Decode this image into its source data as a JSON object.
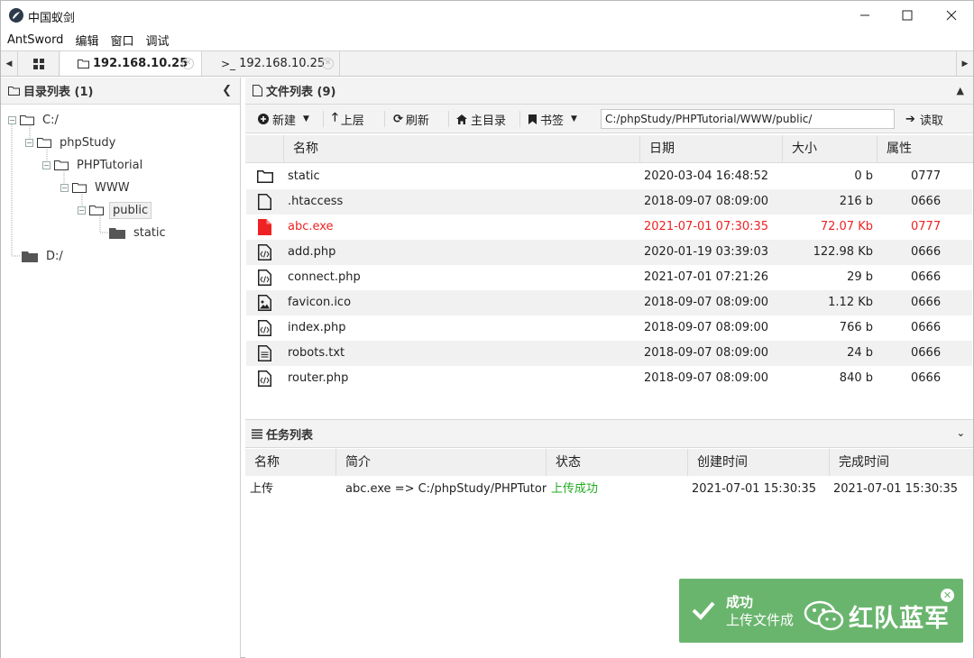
{
  "window": {
    "title": "中国蚁剑"
  },
  "menu": [
    "AntSword",
    "编辑",
    "窗口",
    "调试"
  ],
  "tabs": [
    {
      "label": "192.168.10.25"
    },
    {
      "label": "192.168.10.25"
    }
  ],
  "sidebar": {
    "title": "目录列表 (1)",
    "tree": [
      {
        "label": "C:/"
      },
      {
        "label": "phpStudy"
      },
      {
        "label": "PHPTutorial"
      },
      {
        "label": "WWW"
      },
      {
        "label": "public"
      },
      {
        "label": "static"
      },
      {
        "label": "D:/"
      }
    ]
  },
  "files": {
    "title": "文件列表 (9)",
    "toolbar": {
      "new_label": "新建",
      "up_label": "上层",
      "refresh_label": "刷新",
      "home_label": "主目录",
      "bookmark_label": "书签",
      "read_label": "读取",
      "path_value": "C:/phpStudy/PHPTutorial/WWW/public/"
    },
    "columns": [
      "名称",
      "日期",
      "大小",
      "属性"
    ],
    "rows": [
      {
        "icon": "folder-icon",
        "name": "static",
        "date": "2020-03-04 16:48:52",
        "size": "0 b",
        "attr": "0777"
      },
      {
        "icon": "file-icon",
        "name": ".htaccess",
        "date": "2018-09-07 08:09:00",
        "size": "216 b",
        "attr": "0666"
      },
      {
        "icon": "exe-file-icon",
        "name": "abc.exe",
        "date": "2021-07-01 07:30:35",
        "size": "72.07 Kb",
        "attr": "0777",
        "highlight": "#ee2222"
      },
      {
        "icon": "code-file-icon",
        "name": "add.php",
        "date": "2020-01-19 03:39:03",
        "size": "122.98 Kb",
        "attr": "0666"
      },
      {
        "icon": "code-file-icon",
        "name": "connect.php",
        "date": "2021-07-01 07:21:26",
        "size": "29 b",
        "attr": "0666"
      },
      {
        "icon": "image-file-icon",
        "name": "favicon.ico",
        "date": "2018-09-07 08:09:00",
        "size": "1.12 Kb",
        "attr": "0666"
      },
      {
        "icon": "code-file-icon",
        "name": "index.php",
        "date": "2018-09-07 08:09:00",
        "size": "766 b",
        "attr": "0666"
      },
      {
        "icon": "text-file-icon",
        "name": "robots.txt",
        "date": "2018-09-07 08:09:00",
        "size": "24 b",
        "attr": "0666"
      },
      {
        "icon": "code-file-icon",
        "name": "router.php",
        "date": "2018-09-07 08:09:00",
        "size": "840 b",
        "attr": "0666"
      }
    ]
  },
  "tasks": {
    "title": "任务列表",
    "columns": [
      "名称",
      "简介",
      "状态",
      "创建时间",
      "完成时间"
    ],
    "rows": [
      {
        "name": "上传",
        "desc": "abc.exe => C:/phpStudy/PHPTutoria",
        "status": "上传成功",
        "created": "2021-07-01 15:30:35",
        "finished": "2021-07-01 15:30:35"
      }
    ]
  },
  "toast": {
    "title": "成功",
    "message": "上传文件成",
    "watermark": "红队蓝军",
    "color": "#6ab56e"
  },
  "colors": {
    "success_text": "#22aa22",
    "error_text": "#ee2222"
  }
}
